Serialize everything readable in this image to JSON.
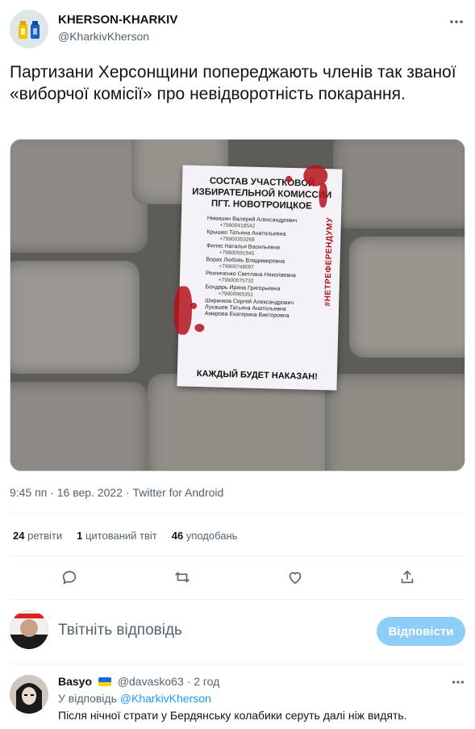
{
  "author": {
    "name": "KHERSON-KHARKIV",
    "handle": "@KharkivKherson"
  },
  "tweet": {
    "text": "Партизани Херсонщини попереджають членів так званої «виборчої комісії» про невідворотність покарання.",
    "image": {
      "flyer_title": "СОСТАВ УЧАСТКОВОЙ ИЗБИРАТЕЛЬНОЙ КОМИССИИ ПГТ. НОВОТРОИЦКОЕ",
      "flyer_tag": "#НЕТРЕФЕРЕНДУМУ",
      "flyer_footer": "КАЖДЫЙ БУДЕТ НАКАЗАН!",
      "members": [
        {
          "name": "Никишин Валерий Александрович",
          "phone": "+79900418542"
        },
        {
          "name": "Крышко Татьяна Анатольевна",
          "phone": "+79900353268"
        },
        {
          "name": "Филяс Наталья Васильевна",
          "phone": "+79900591945"
        },
        {
          "name": "Ворах Любовь Владимировна",
          "phone": "+79900748097"
        },
        {
          "name": "Резниченко Светлана Николаевна",
          "phone": "+79900075732"
        },
        {
          "name": "Бондарь Ирина Григорьевна",
          "phone": "+79900965351"
        },
        {
          "name": "Ширинков Сергей Александрович",
          "phone": ""
        },
        {
          "name": "Лукашев Татьяна Анатольевна",
          "phone": ""
        },
        {
          "name": "Амирова Екатерина Викторовна",
          "phone": ""
        }
      ]
    },
    "time": "9:45 пп",
    "date": "16 вер. 2022",
    "source": "Twitter for Android",
    "separator": "·"
  },
  "stats": {
    "retweets": {
      "count": "24",
      "label": "ретвіти"
    },
    "quotes": {
      "count": "1",
      "label": "цитований твіт"
    },
    "likes": {
      "count": "46",
      "label": "уподобань"
    }
  },
  "reply_box": {
    "placeholder": "Твітніть відповідь",
    "button_label": "Відповісти"
  },
  "reply": {
    "name": "Basyo",
    "handle": "@davasko63",
    "separator": "·",
    "time": "2 год",
    "reply_to_label": "У відповідь",
    "reply_to_handle": "@KharkivKherson",
    "text": "Після нічної страти у Бердянську колабики серуть далі ніж видять."
  },
  "colors": {
    "accent": "#1d9bf0",
    "secondary_text": "#536471",
    "button_disabled": "#8ecdf8"
  }
}
